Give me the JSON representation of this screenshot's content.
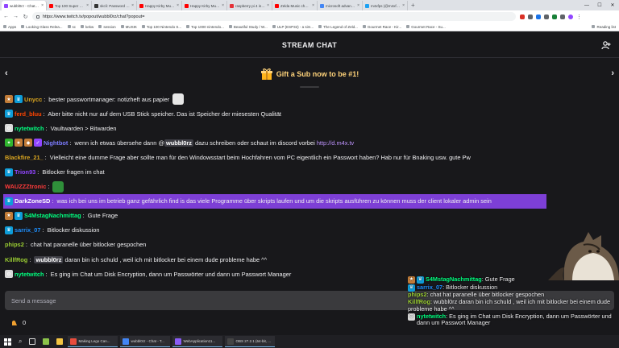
{
  "browser": {
    "tabs": [
      {
        "label": "wubbl0rz - Chat - Twi",
        "active": true,
        "color": "#9146ff"
      },
      {
        "label": "Top 100 Super Mario",
        "active": false,
        "color": "#ff0000"
      },
      {
        "label": "skcli: Password Stren",
        "active": false,
        "color": "#333333"
      },
      {
        "label": "Happy Kirby Music Mi",
        "active": false,
        "color": "#ff0000"
      },
      {
        "label": "Happy Kirby Music Mi",
        "active": false,
        "color": "#ff0000"
      },
      {
        "label": "raspberry pi 4 in | eBa",
        "active": false,
        "color": "#e53238"
      },
      {
        "label": "Zelda Music chosen b",
        "active": false,
        "color": "#ff0000"
      },
      {
        "label": "microsoft advanced t",
        "active": false,
        "color": "#4285f4"
      },
      {
        "label": "m4xfps (@m4xfps) / T",
        "active": false,
        "color": "#1da1f2"
      }
    ],
    "new_tab": "+",
    "window_controls": {
      "minimize": "—",
      "maximize": "☐",
      "close": "✕"
    },
    "url": "https://www.twitch.tv/popout/wubbl0rz/chat?popout=",
    "bookmarks": [
      "Apps",
      "Looking Glass Relea...",
      "sc",
      "kekw",
      "session",
      "MUSIK",
      "Top 100 Nintendo S...",
      "Top 1000 nintendo...",
      "Beautiful Study / W...",
      "ULP (ESP32) - a sim...",
      "The Legend of Zeld...",
      "Gourmet Race - Kir...",
      "Gourmet Race - Su..."
    ],
    "reading_list": "Reading list"
  },
  "chat": {
    "title": "STREAM CHAT",
    "gift_banner": "Gift a Sub now to be #1!",
    "nav_prev": "‹",
    "nav_next": "›",
    "send_placeholder": "Send a message",
    "points": "0",
    "messages": [
      {
        "badges": [
          "sub",
          "prime"
        ],
        "user": "Unycc",
        "color": "#daa520",
        "parts": [
          {
            "t": "text",
            "v": " bester passwortmanager: notizheft aus papier "
          }
        ],
        "emote": "ghost"
      },
      {
        "badges": [
          "prime"
        ],
        "user": "ferd_bluu",
        "color": "#ff4500",
        "parts": [
          {
            "t": "text",
            "v": " Aber bitte nicht nur auf dem USB Stick speicher. Das ist Speicher der miesesten Qualität"
          }
        ]
      },
      {
        "badges": [
          "gear"
        ],
        "user": "nytetwitch",
        "color": "#00ff7f",
        "parts": [
          {
            "t": "text",
            "v": " Vaultwarden > Bitwarden"
          }
        ]
      },
      {
        "badges": [
          "vip",
          "sub",
          "gift",
          "verified"
        ],
        "user": "Nightbot",
        "color": "#7c7cff",
        "parts": [
          {
            "t": "text",
            "v": " wenn ich etwas übersehe dann @"
          },
          {
            "t": "mention",
            "v": "wubbl0rz"
          },
          {
            "t": "text",
            "v": " dazu schreiben oder schaut im discord vorbei "
          },
          {
            "t": "link",
            "v": "http://d.m4x.tv"
          }
        ]
      },
      {
        "badges": [],
        "user": "Blackfire_21_",
        "color": "#daa520",
        "parts": [
          {
            "t": "text",
            "v": " Vielleicht eine dumme Frage aber sollte man für den Windowsstart beim Hochfahren vom PC eigentlich ein Passwort haben? Hab nur für Bnaking usw. gute Pw"
          }
        ]
      },
      {
        "badges": [
          "prime"
        ],
        "user": "Trion93",
        "color": "#9146ff",
        "parts": [
          {
            "t": "text",
            "v": " Bitlocker fragen im chat"
          }
        ]
      },
      {
        "badges": [],
        "user": "WAUZZZtronic",
        "color": "#ff3b3b",
        "parts": [
          {
            "t": "text",
            "v": ""
          }
        ],
        "emote": "frog"
      },
      {
        "badges": [
          "prime"
        ],
        "user": "DarkZoneSD",
        "color": "#ffffff",
        "highlight": true,
        "parts": [
          {
            "t": "text",
            "v": " was ich bei uns im betrieb ganz gefährlich find is das viele Programme über skripts laufen und um die skripts ausführen zu können muss der client lokaler admin sein"
          }
        ]
      },
      {
        "badges": [
          "sub",
          "prime"
        ],
        "user": "S4MstagNachmittag",
        "color": "#00ff7f",
        "parts": [
          {
            "t": "text",
            "v": " Gute Frage"
          }
        ]
      },
      {
        "badges": [
          "prime"
        ],
        "user": "sarrix_07",
        "color": "#1e90ff",
        "parts": [
          {
            "t": "text",
            "v": " Bitlocker diskussion"
          }
        ]
      },
      {
        "badges": [],
        "user": "phips2",
        "color": "#9acd32",
        "parts": [
          {
            "t": "text",
            "v": " chat hat paranelle über bitlocker gespochen"
          }
        ]
      },
      {
        "badges": [],
        "user": "KillfRog",
        "color": "#9acd32",
        "parts": [
          {
            "t": "text",
            "v": " "
          },
          {
            "t": "mention",
            "v": "wubbl0rz"
          },
          {
            "t": "text",
            "v": " daran bin ich schuld , weil ich mit bitlocker bei einem dude probleme habe ^^"
          }
        ]
      },
      {
        "badges": [
          "gear"
        ],
        "user": "nytetwitch",
        "color": "#00ff7f",
        "parts": [
          {
            "t": "text",
            "v": " Es ging im Chat um Disk Encryption, dann um Passwörter und dann um Passwort Manager"
          }
        ]
      }
    ]
  },
  "overlay": {
    "messages": [
      {
        "badges": [
          "sub",
          "prime"
        ],
        "user": "S4MstagNachmittag",
        "color": "#00ff7f",
        "text": " Gute Frage"
      },
      {
        "badges": [
          "prime"
        ],
        "user": "sarrix_07",
        "color": "#1e90ff",
        "text": " Bitlocker diskussion"
      },
      {
        "badges": [],
        "user": "phips2",
        "color": "#9acd32",
        "text": " chat hat paranelle über bitlocker gespochen"
      },
      {
        "badges": [],
        "user": "KillfRog",
        "color": "#9acd32",
        "text": " wubbl0rz daran bin ich schuld , weil ich mit bitlocker bei einem dude probleme habe ^^"
      },
      {
        "badges": [
          "gear"
        ],
        "user": "nytetwitch",
        "color": "#00ff7f",
        "text": " Es ging im Chat um Disk Encryption, dann um Passwörter und dann um Passwort Manager"
      }
    ]
  },
  "taskbar": {
    "apps": [
      {
        "label": "Making Lego Can...",
        "color": "#e84c3d"
      },
      {
        "label": "wubbl0rz - Chat - T...",
        "color": "#4285f4"
      },
      {
        "label": "WebApplication11...",
        "color": "#8a5cf6"
      },
      {
        "label": "OBS 27.2.1 (64-bit, ...",
        "color": "#444444"
      }
    ]
  },
  "colors": {
    "accent": "#9146ff",
    "highlight": "#7d3fd6",
    "gift": "#ffd37a",
    "background": "#18181b"
  }
}
